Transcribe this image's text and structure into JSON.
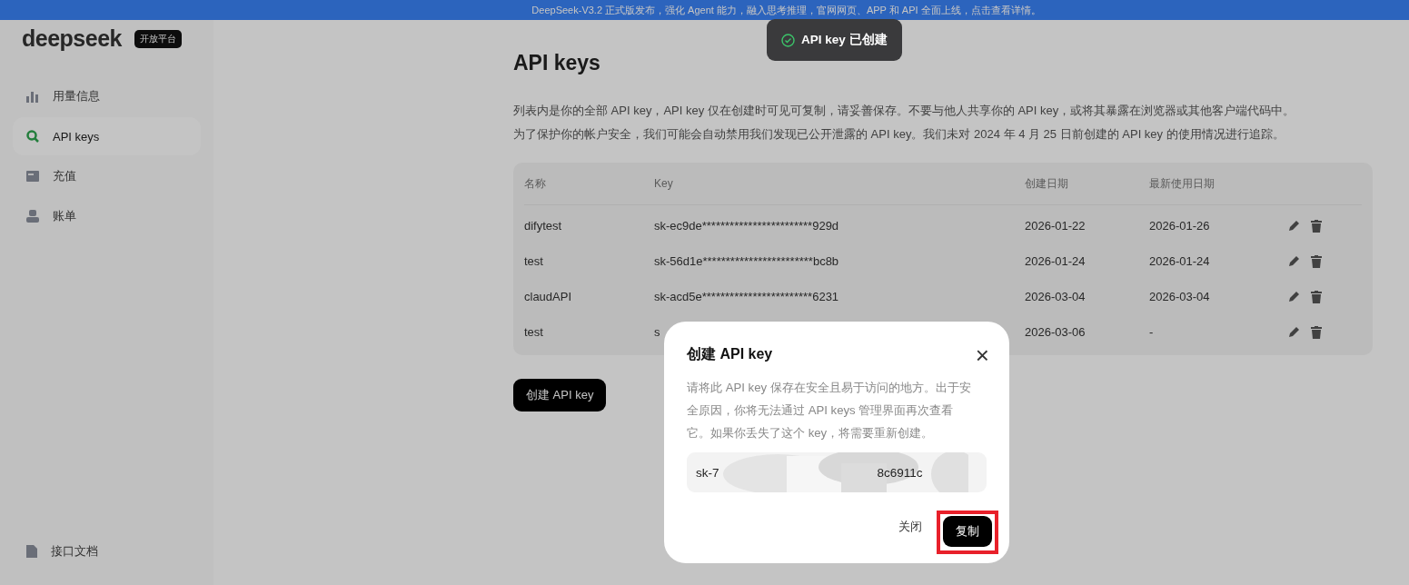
{
  "banner": {
    "text": "DeepSeek-V3.2 正式版发布，强化 Agent 能力，融入思考推理，官网网页、APP 和 API 全面上线，点击查看详情。"
  },
  "sidebar": {
    "logo": "deepseek",
    "badge": "开放平台",
    "items": [
      {
        "label": "用量信息",
        "selected": false
      },
      {
        "label": "API keys",
        "selected": true
      },
      {
        "label": "充值",
        "selected": false
      },
      {
        "label": "账单",
        "selected": false
      }
    ],
    "footer_item": {
      "label": "接口文档"
    }
  },
  "main": {
    "title": "API keys",
    "description": [
      "列表内是你的全部 API key，API key 仅在创建时可见可复制，请妥善保存。不要与他人共享你的 API key，或将其暴露在浏览器或其他客户端代码中。",
      "为了保护你的帐户安全，我们可能会自动禁用我们发现已公开泄露的 API key。我们未对 2024 年 4 月 25 日前创建的 API key 的使用情况进行追踪。"
    ],
    "table": {
      "columns": [
        "名称",
        "Key",
        "创建日期",
        "最新使用日期"
      ],
      "rows": [
        {
          "name": "difytest",
          "key": "sk-ec9de************************929d",
          "created": "2026-01-22",
          "last_used": "2026-01-26"
        },
        {
          "name": "test",
          "key": "sk-56d1e************************bc8b",
          "created": "2026-01-24",
          "last_used": "2026-01-24"
        },
        {
          "name": "claudAPI",
          "key": "sk-acd5e************************6231",
          "created": "2026-03-04",
          "last_used": "2026-03-04"
        },
        {
          "name": "test",
          "key": "s",
          "created": "2026-03-06",
          "last_used": "-"
        }
      ]
    },
    "create_button": "创建 API key"
  },
  "toast": {
    "text": "API key 已创建"
  },
  "dialog": {
    "title": "创建 API key",
    "close": "×",
    "message": "请将此 API key 保存在安全且易于访问的地方。出于安全原因，你将无法通过 API keys 管理界面再次查看它。如果你丢失了这个 key，将需要重新创建。",
    "key_parts": [
      "sk-7",
      "8c6911c"
    ],
    "redacted": true,
    "buttons": [
      {
        "label": "关闭",
        "kind": "text",
        "highlighted": false
      },
      {
        "label": "复制",
        "kind": "primary",
        "highlighted": true
      }
    ]
  }
}
